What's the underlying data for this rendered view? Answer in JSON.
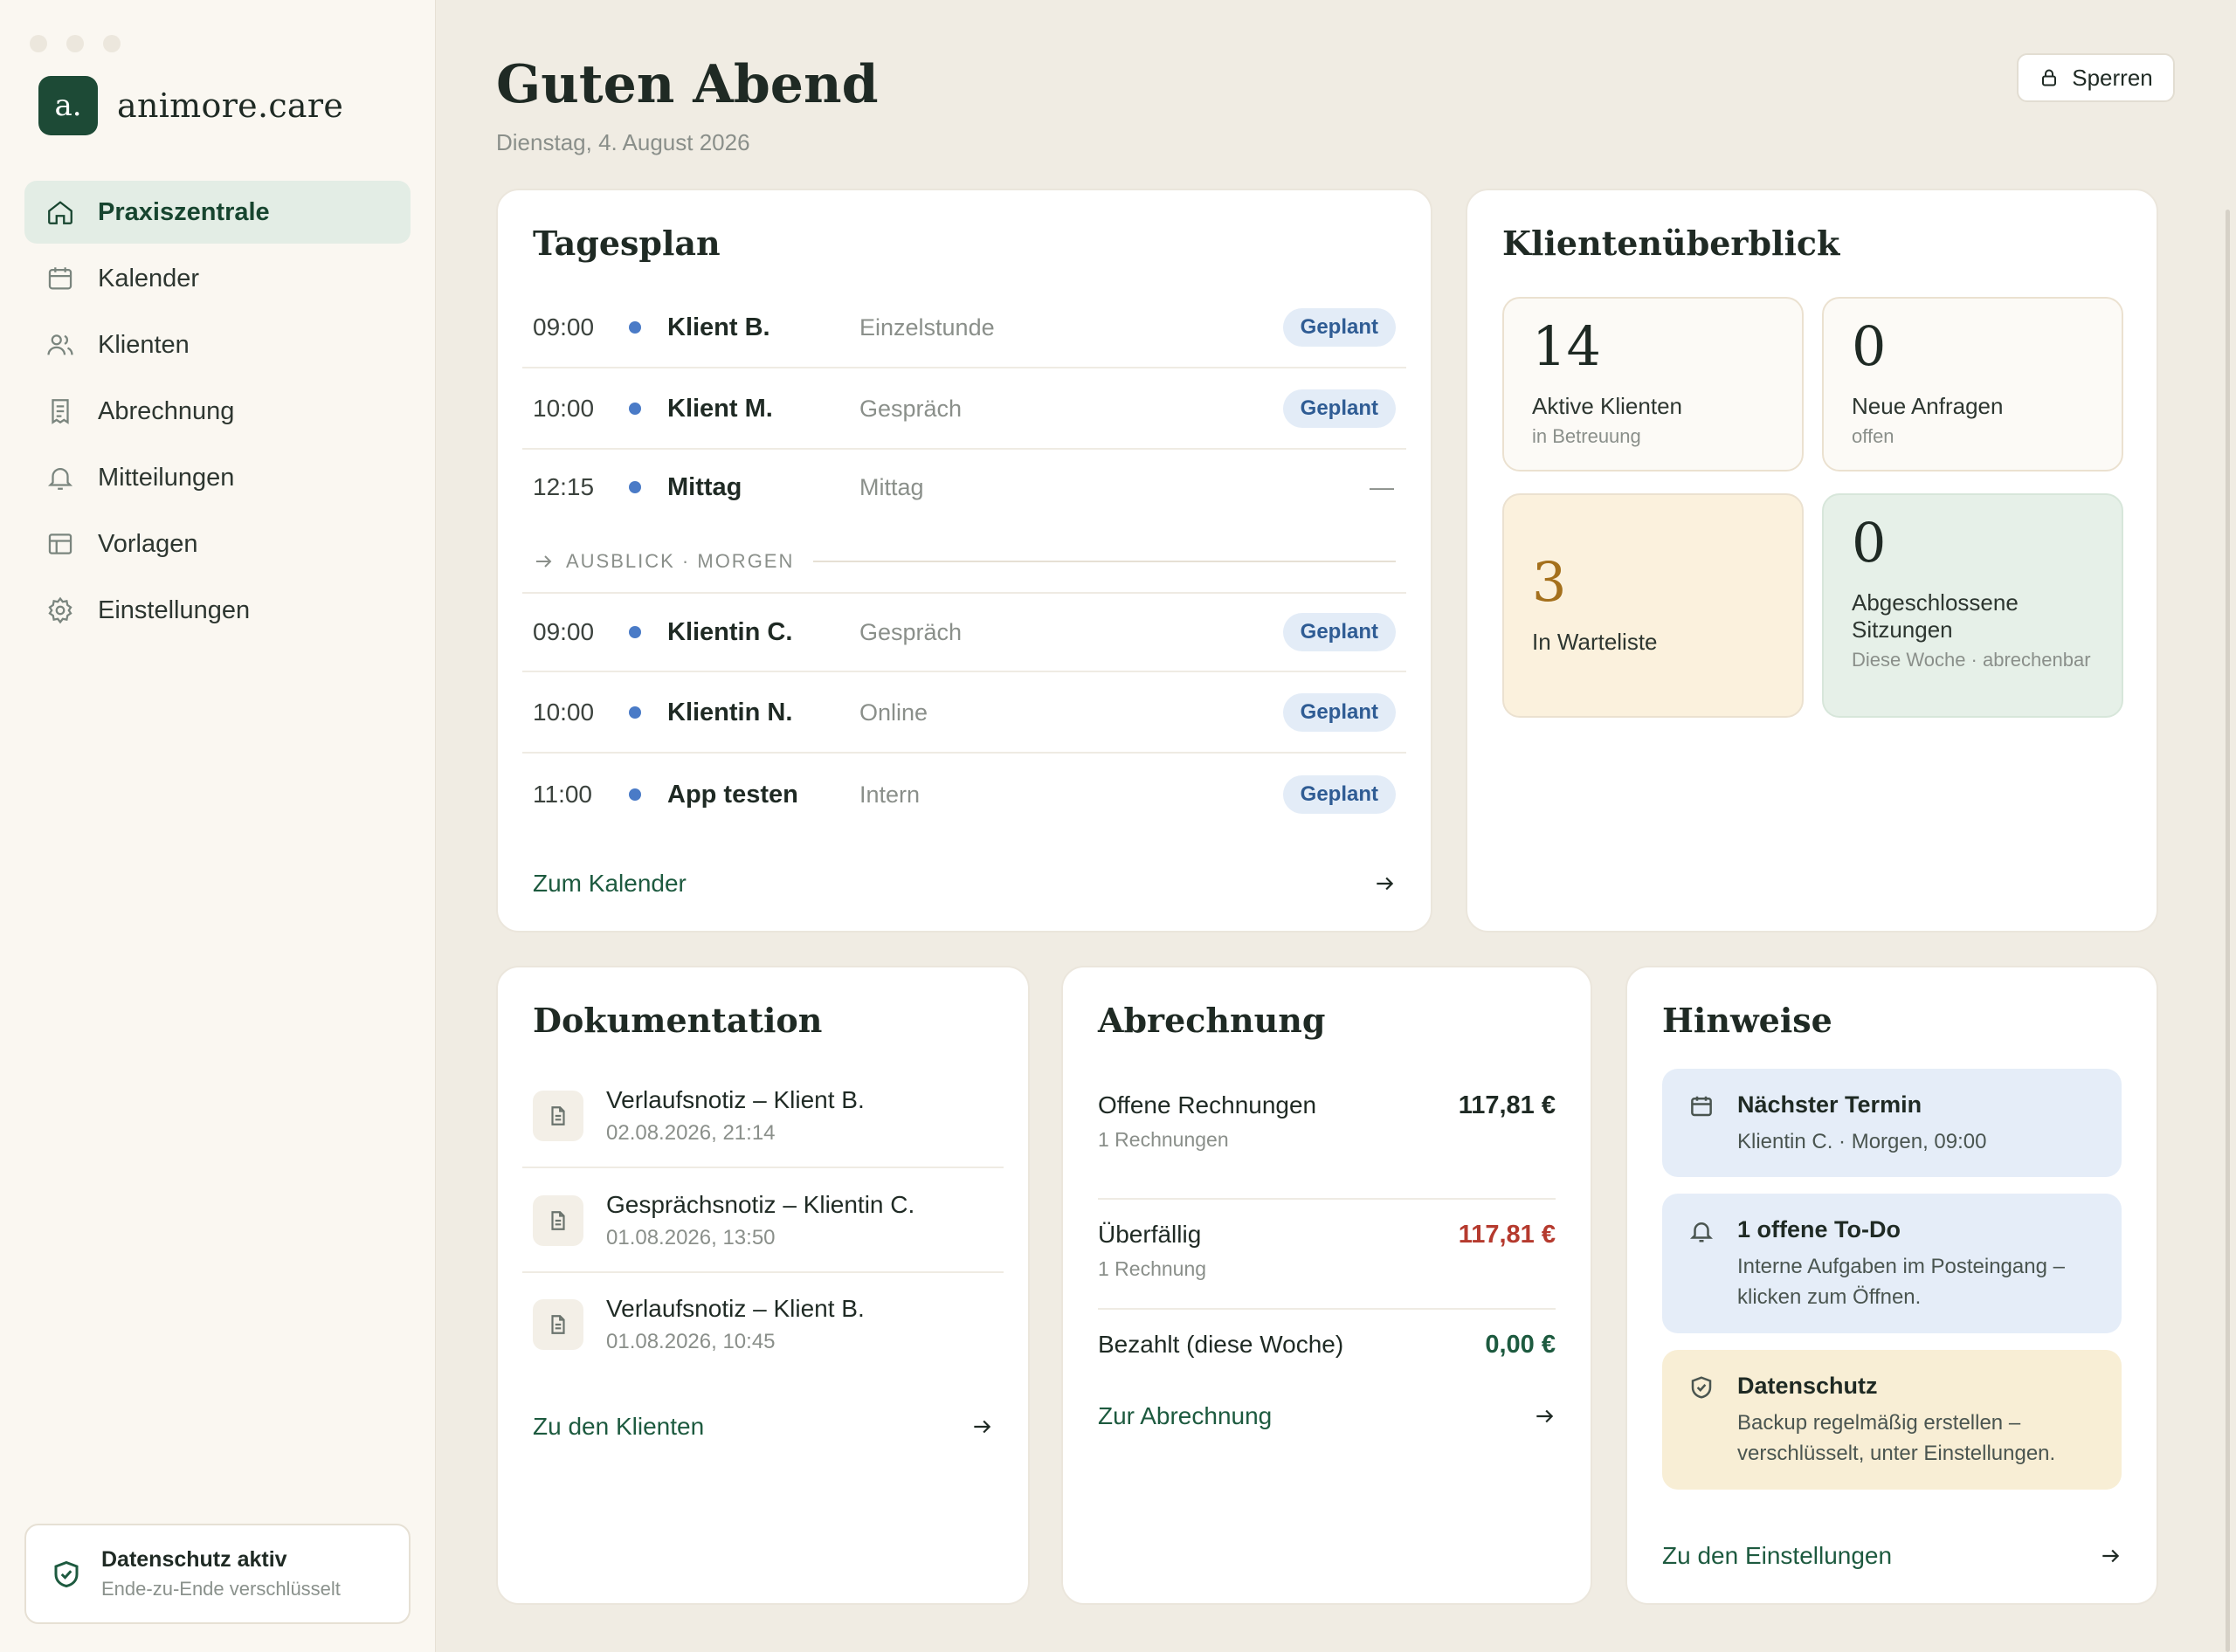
{
  "brand": {
    "logo_text": "a.",
    "name": "animore.care"
  },
  "nav": [
    {
      "label": "Praxiszentrale",
      "icon": "home-icon",
      "active": true
    },
    {
      "label": "Kalender",
      "icon": "calendar-icon"
    },
    {
      "label": "Klienten",
      "icon": "users-icon"
    },
    {
      "label": "Abrechnung",
      "icon": "receipt-icon"
    },
    {
      "label": "Mitteilungen",
      "icon": "bell-icon"
    },
    {
      "label": "Vorlagen",
      "icon": "template-icon"
    },
    {
      "label": "Einstellungen",
      "icon": "gear-icon"
    }
  ],
  "privacy": {
    "title": "Datenschutz aktiv",
    "subtitle": "Ende-zu-Ende verschlüsselt"
  },
  "header": {
    "greeting": "Guten Abend",
    "date": "Dienstag, 4. August 2026",
    "lock_label": "Sperren"
  },
  "tagesplan": {
    "title": "Tagesplan",
    "today": [
      {
        "time": "09:00",
        "name": "Klient B.",
        "type": "Einzelstunde",
        "status": "Geplant"
      },
      {
        "time": "10:00",
        "name": "Klient M.",
        "type": "Gespräch",
        "status": "Geplant"
      },
      {
        "time": "12:15",
        "name": "Mittag",
        "type": "Mittag",
        "status": "—"
      }
    ],
    "outlook_label": "AUSBLICK · MORGEN",
    "tomorrow": [
      {
        "time": "09:00",
        "name": "Klientin C.",
        "type": "Gespräch",
        "status": "Geplant"
      },
      {
        "time": "10:00",
        "name": "Klientin N.",
        "type": "Online",
        "status": "Geplant"
      },
      {
        "time": "11:00",
        "name": "App testen",
        "type": "Intern",
        "status": "Geplant"
      }
    ],
    "link": "Zum Kalender"
  },
  "klienten": {
    "title": "Klientenüberblick",
    "stats": [
      {
        "num": "14",
        "label": "Aktive Klienten",
        "sub": "in Betreuung"
      },
      {
        "num": "0",
        "label": "Neue Anfragen",
        "sub": "offen"
      },
      {
        "num": "3",
        "label": "In Warteliste",
        "sub": ""
      },
      {
        "num": "0",
        "label": "Abgeschlossene Sitzungen",
        "sub": "Diese Woche · abrechenbar"
      }
    ]
  },
  "dokumentation": {
    "title": "Dokumentation",
    "items": [
      {
        "title": "Verlaufsnotiz – Klient B.",
        "date": "02.08.2026, 21:14"
      },
      {
        "title": "Gesprächsnotiz – Klientin C.",
        "date": "01.08.2026, 13:50"
      },
      {
        "title": "Verlaufsnotiz – Klient B.",
        "date": "01.08.2026, 10:45"
      }
    ],
    "link": "Zu den Klienten"
  },
  "abrechnung": {
    "title": "Abrechnung",
    "rows": [
      {
        "label": "Offene Rechnungen",
        "sub": "1 Rechnungen",
        "amount": "117,81 €",
        "color": "#1f2a24"
      },
      {
        "label": "Überfällig",
        "sub": "1 Rechnung",
        "amount": "117,81 €",
        "color": "#b53a2e"
      },
      {
        "label": "Bezahlt (diese Woche)",
        "sub": "",
        "amount": "0,00 €",
        "color": "#1d5a3f"
      }
    ],
    "link": "Zur Abrechnung"
  },
  "hinweise": {
    "title": "Hinweise",
    "items": [
      {
        "icon": "calendar-icon",
        "title": "Nächster Termin",
        "text": "Klientin C. · Morgen, 09:00"
      },
      {
        "icon": "bell-icon",
        "title": "1 offene To-Do",
        "text": "Interne Aufgaben im Posteingang – klicken zum Öffnen."
      },
      {
        "icon": "shield-icon",
        "title": "Datenschutz",
        "text": "Backup regelmäßig erstellen – verschlüsselt, unter Einstellungen."
      }
    ],
    "link": "Zu den Einstellungen"
  },
  "colors": {
    "accent": "#1d4a36",
    "background": "#f0ece3",
    "badge_bg": "#e3ecf7",
    "overdue": "#b53a2e",
    "warteliste_bg": "#fbf1dd",
    "completed_bg": "#e6f0e8",
    "hint_blue": "#e5edf8",
    "hint_yellow": "#f8eed5"
  }
}
